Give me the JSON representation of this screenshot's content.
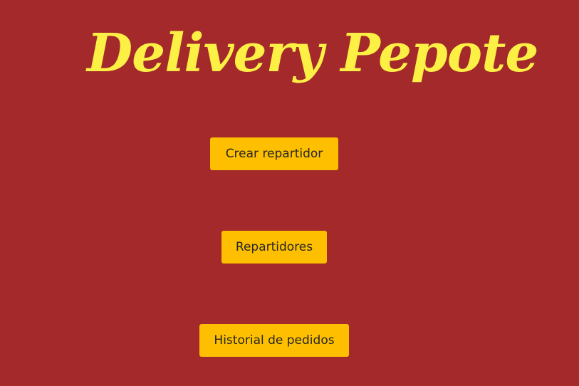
{
  "header": {
    "title": "Delivery Pepote"
  },
  "menu": {
    "buttons": [
      {
        "label": "Crear repartidor"
      },
      {
        "label": "Repartidores"
      },
      {
        "label": "Historial de pedidos"
      }
    ]
  },
  "colors": {
    "background": "#a4292b",
    "title": "#fdf045",
    "button": "#fdbf00",
    "button_text": "#262626"
  }
}
